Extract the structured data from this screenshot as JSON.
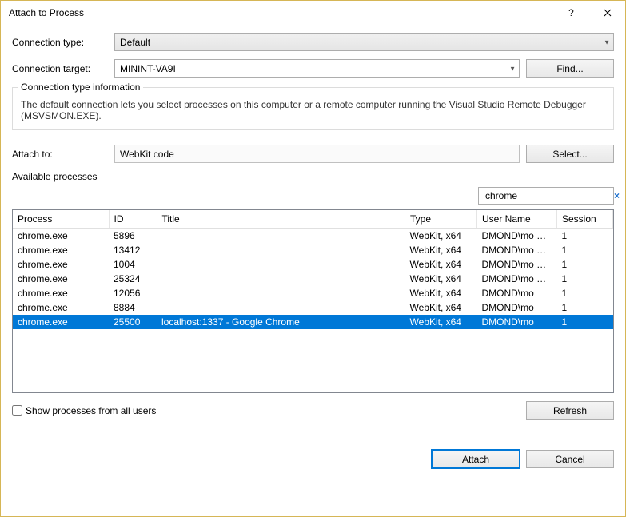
{
  "title": "Attach to Process",
  "labels": {
    "connection_type": "Connection type:",
    "connection_target": "Connection target:",
    "attach_to": "Attach to:",
    "group_title": "Connection type information",
    "group_body": "The default connection lets you select processes on this computer or a remote computer running the Visual Studio Remote Debugger (MSVSMON.EXE).",
    "available_processes": "Available processes",
    "show_all": "Show processes from all users"
  },
  "values": {
    "connection_type": "Default",
    "connection_target": "MININT-VA9I",
    "attach_to": "WebKit code",
    "filter": "chrome"
  },
  "buttons": {
    "find": "Find...",
    "select": "Select...",
    "refresh": "Refresh",
    "attach": "Attach",
    "cancel": "Cancel"
  },
  "columns": {
    "process": "Process",
    "id": "ID",
    "title": "Title",
    "type": "Type",
    "user": "User Name",
    "session": "Session"
  },
  "processes": [
    {
      "process": "chrome.exe",
      "id": "5896",
      "title": "",
      "type": "WebKit, x64",
      "user": "DMOND\\mo …",
      "session": "1",
      "selected": false
    },
    {
      "process": "chrome.exe",
      "id": "13412",
      "title": "",
      "type": "WebKit, x64",
      "user": "DMOND\\mo …",
      "session": "1",
      "selected": false
    },
    {
      "process": "chrome.exe",
      "id": "1004",
      "title": "",
      "type": "WebKit, x64",
      "user": "DMOND\\mo …",
      "session": "1",
      "selected": false
    },
    {
      "process": "chrome.exe",
      "id": "25324",
      "title": "",
      "type": "WebKit, x64",
      "user": "DMOND\\mo …",
      "session": "1",
      "selected": false
    },
    {
      "process": "chrome.exe",
      "id": "12056",
      "title": "",
      "type": "WebKit, x64",
      "user": "DMOND\\mo",
      "session": "1",
      "selected": false
    },
    {
      "process": "chrome.exe",
      "id": "8884",
      "title": "",
      "type": "WebKit, x64",
      "user": "DMOND\\mo",
      "session": "1",
      "selected": false
    },
    {
      "process": "chrome.exe",
      "id": "25500",
      "title": "localhost:1337 - Google Chrome",
      "type": "WebKit, x64",
      "user": "DMOND\\mo",
      "session": "1",
      "selected": true
    }
  ]
}
